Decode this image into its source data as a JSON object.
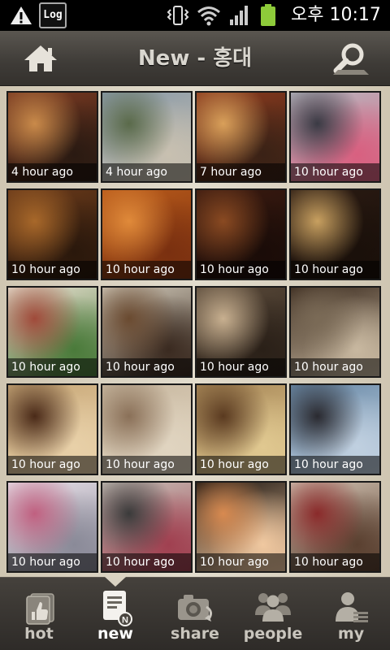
{
  "status_bar": {
    "log_label": "Log",
    "time": "오후 10:17",
    "icons": [
      "warning-icon",
      "log-icon",
      "vibrate-icon",
      "wifi-icon",
      "signal-icon",
      "battery-icon"
    ]
  },
  "header": {
    "title": "New - 홍대",
    "icons": [
      "home-icon",
      "search-icon"
    ]
  },
  "grid": {
    "tiles": [
      {
        "caption": "4 hour ago",
        "colors": [
          "#7a3a22",
          "#c98a4a",
          "#2a1a12"
        ]
      },
      {
        "caption": "4 hour ago",
        "colors": [
          "#8a9aa8",
          "#5a6a4a",
          "#c8c0b0"
        ]
      },
      {
        "caption": "7 hour ago",
        "colors": [
          "#8a3a1e",
          "#d9a05a",
          "#3a2216"
        ]
      },
      {
        "caption": "10 hour ago",
        "colors": [
          "#b8b8c0",
          "#3a3a44",
          "#d86080"
        ]
      },
      {
        "caption": "10 hour ago",
        "colors": [
          "#6a3a1a",
          "#a8682a",
          "#2a180c"
        ]
      },
      {
        "caption": "10 hour ago",
        "colors": [
          "#b85a1a",
          "#e08a3a",
          "#7a3010"
        ]
      },
      {
        "caption": "10 hour ago",
        "colors": [
          "#3a1a10",
          "#8a4a22",
          "#1a0c08"
        ]
      },
      {
        "caption": "10 hour ago",
        "colors": [
          "#2a1a12",
          "#c8a060",
          "#1a100a"
        ]
      },
      {
        "caption": "10 hour ago",
        "colors": [
          "#e8e0d0",
          "#a04a3a",
          "#4a7a3a"
        ]
      },
      {
        "caption": "10 hour ago",
        "colors": [
          "#d0c8b8",
          "#6a4a30",
          "#3a2a20"
        ]
      },
      {
        "caption": "10 hour ago",
        "colors": [
          "#5a4a3a",
          "#c8b090",
          "#2a2018"
        ]
      },
      {
        "caption": "10 hour ago",
        "colors": [
          "#3a2a1e",
          "#7a6a56",
          "#c8b8a0"
        ]
      },
      {
        "caption": "10 hour ago",
        "colors": [
          "#c8a878",
          "#4a2a18",
          "#e8d0a8"
        ]
      },
      {
        "caption": "10 hour ago",
        "colors": [
          "#c8b8a0",
          "#8a7058",
          "#e0d4c0"
        ]
      },
      {
        "caption": "10 hour ago",
        "colors": [
          "#a88858",
          "#5a3a20",
          "#e0c890"
        ]
      },
      {
        "caption": "10 hour ago",
        "colors": [
          "#6a8aa8",
          "#2a2a30",
          "#c0d0e0"
        ]
      },
      {
        "caption": "10 hour ago",
        "colors": [
          "#e8e0e8",
          "#c06080",
          "#8a8a98"
        ]
      },
      {
        "caption": "10 hour ago",
        "colors": [
          "#c8c0b8",
          "#3a3a3a",
          "#a04050"
        ]
      },
      {
        "caption": "10 hour ago",
        "colors": [
          "#1a1410",
          "#d88a50",
          "#f0c8a0"
        ]
      },
      {
        "caption": "10 hour ago",
        "colors": [
          "#d0c0b0",
          "#8a2a2a",
          "#5a4030"
        ]
      }
    ]
  },
  "bottom_nav": {
    "items": [
      {
        "label": "hot",
        "icon": "thumbs-up-icon"
      },
      {
        "label": "new",
        "icon": "new-document-icon",
        "badge": "N"
      },
      {
        "label": "share",
        "icon": "camera-icon"
      },
      {
        "label": "people",
        "icon": "people-icon"
      },
      {
        "label": "my",
        "icon": "profile-icon"
      }
    ],
    "active_index": 1
  }
}
